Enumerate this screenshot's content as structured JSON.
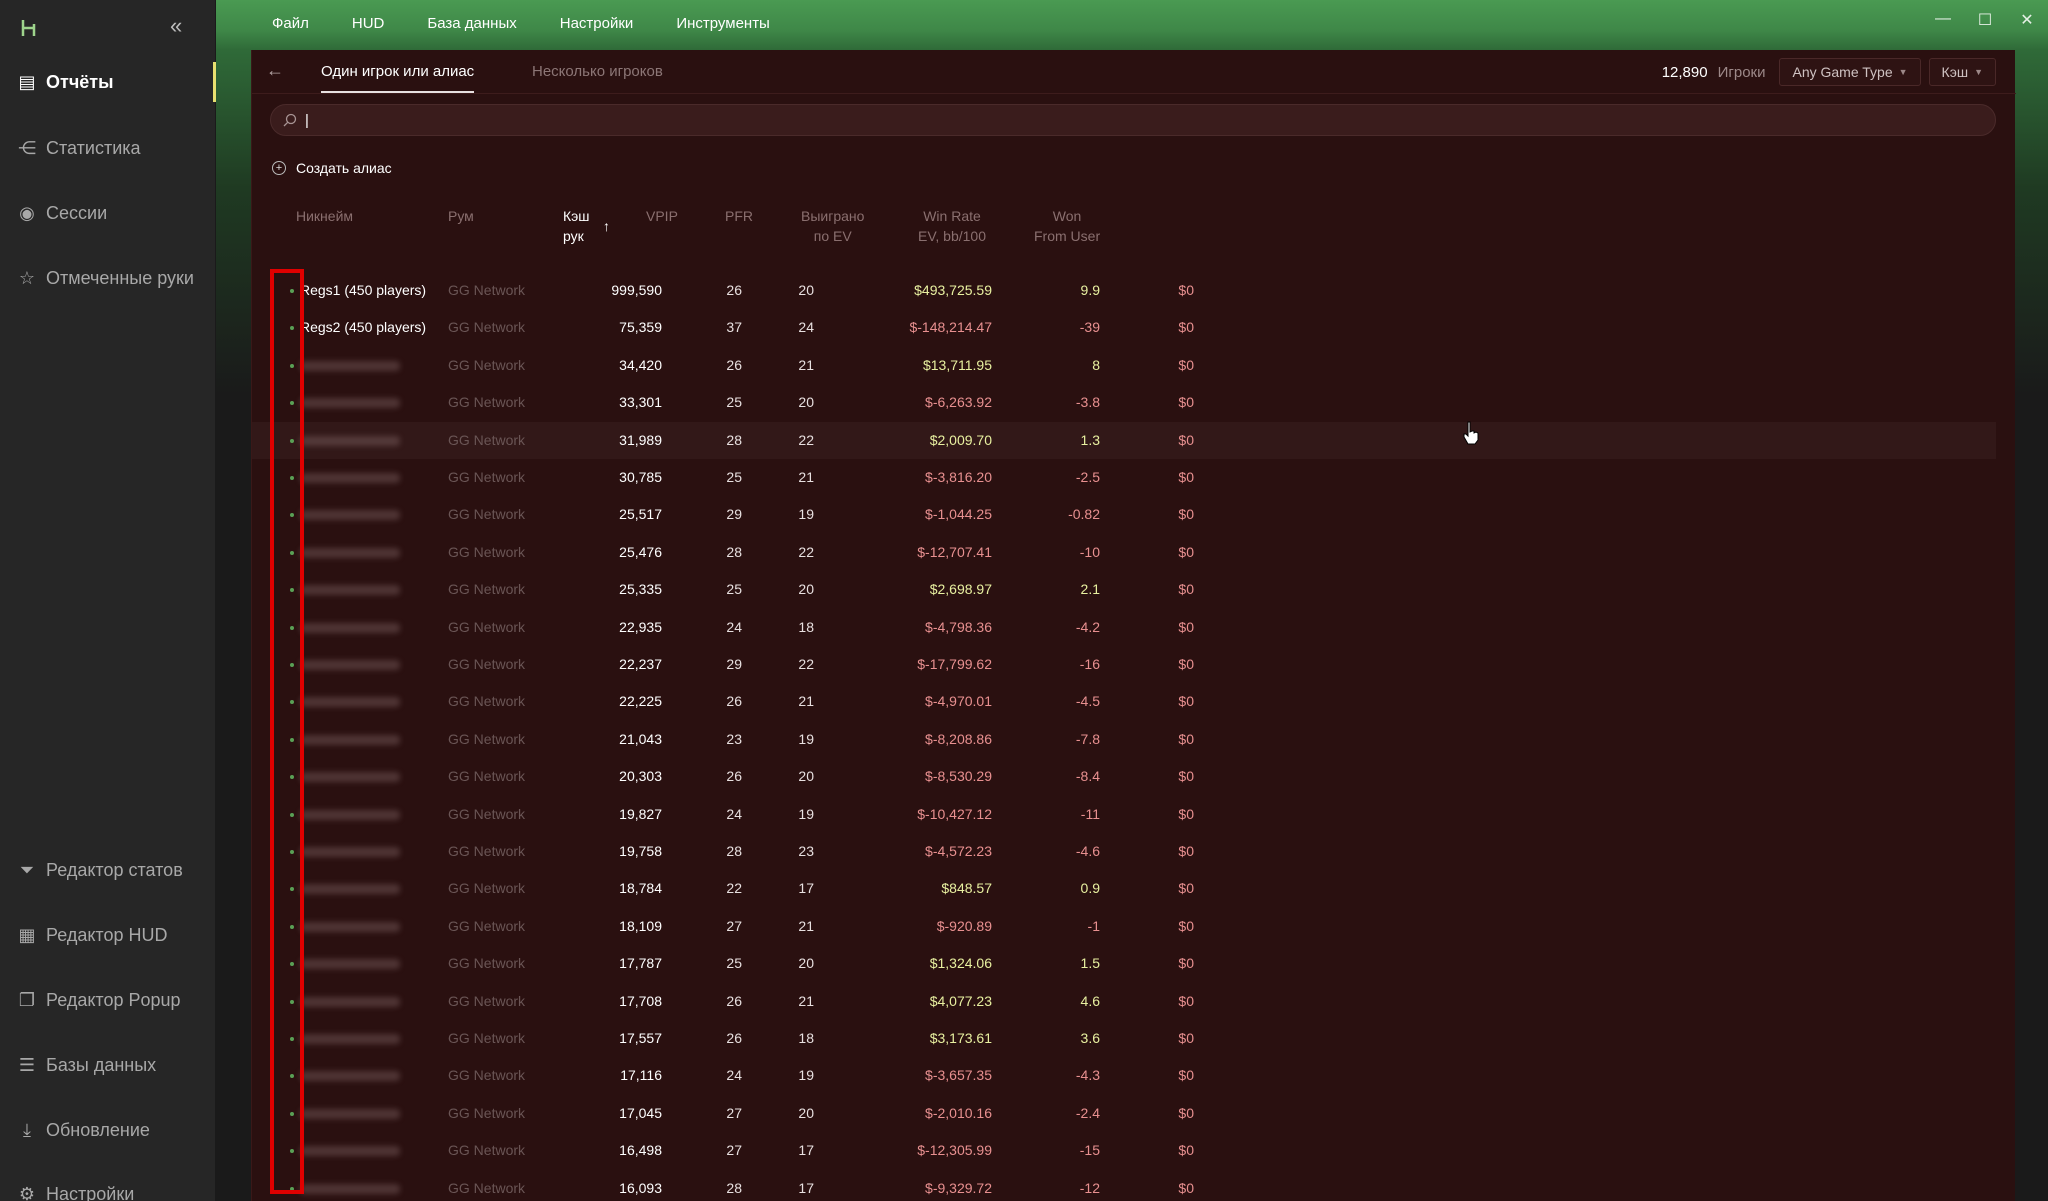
{
  "sidebar": {
    "items": [
      {
        "label": "Отчёты",
        "icon": "report-icon",
        "active": true
      },
      {
        "label": "Статистика",
        "icon": "share-icon"
      },
      {
        "label": "Сессии",
        "icon": "broadcast-icon"
      },
      {
        "label": "Отмеченные руки",
        "icon": "starred-list-icon"
      }
    ],
    "bottom_items": [
      {
        "label": "Редактор статов",
        "icon": "filter-icon"
      },
      {
        "label": "Редактор HUD",
        "icon": "layout-icon"
      },
      {
        "label": "Редактор Popup",
        "icon": "copy-icon"
      },
      {
        "label": "Базы данных",
        "icon": "database-icon"
      },
      {
        "label": "Обновление",
        "icon": "download-icon"
      },
      {
        "label": "Настройки",
        "icon": "gear-icon"
      }
    ]
  },
  "menu": [
    "Файл",
    "HUD",
    "База данных",
    "Настройки",
    "Инструменты"
  ],
  "tabs": {
    "single": "Один игрок или алиас",
    "multi": "Несколько игроков"
  },
  "header": {
    "player_count": "12,890",
    "player_count_label": "Игроки",
    "game_type": "Any Game Type",
    "mode": "Кэш"
  },
  "search": {
    "value": "|"
  },
  "create_alias": "Создать алиас",
  "columns": {
    "nick": "Никнейм",
    "room": "Рум",
    "hands_1": "Кэш",
    "hands_2": "рук",
    "sort_arrow": "↑",
    "vpip": "VPIP",
    "pfr": "PFR",
    "won_1": "Выиграно",
    "won_2": "по EV",
    "wr_1": "Win Rate",
    "wr_2": "EV, bb/100",
    "wfu_1": "Won",
    "wfu_2": "From User"
  },
  "rows": [
    {
      "nick": "Regs1 (450 players)",
      "room": "GG Network",
      "hands": "999,590",
      "vpip": "26",
      "pfr": "20",
      "won": "$493,725.59",
      "wr": "9.9",
      "wfu": "$0"
    },
    {
      "nick": "Regs2 (450 players)",
      "room": "GG Network",
      "hands": "75,359",
      "vpip": "37",
      "pfr": "24",
      "won": "$-148,214.47",
      "wr": "-39",
      "wfu": "$0"
    },
    {
      "nick": "",
      "room": "GG Network",
      "hands": "34,420",
      "vpip": "26",
      "pfr": "21",
      "won": "$13,711.95",
      "wr": "8",
      "wfu": "$0"
    },
    {
      "nick": "",
      "room": "GG Network",
      "hands": "33,301",
      "vpip": "25",
      "pfr": "20",
      "won": "$-6,263.92",
      "wr": "-3.8",
      "wfu": "$0"
    },
    {
      "nick": "",
      "room": "GG Network",
      "hands": "31,989",
      "vpip": "28",
      "pfr": "22",
      "won": "$2,009.70",
      "wr": "1.3",
      "wfu": "$0"
    },
    {
      "nick": "",
      "room": "GG Network",
      "hands": "30,785",
      "vpip": "25",
      "pfr": "21",
      "won": "$-3,816.20",
      "wr": "-2.5",
      "wfu": "$0"
    },
    {
      "nick": "",
      "room": "GG Network",
      "hands": "25,517",
      "vpip": "29",
      "pfr": "19",
      "won": "$-1,044.25",
      "wr": "-0.82",
      "wfu": "$0"
    },
    {
      "nick": "",
      "room": "GG Network",
      "hands": "25,476",
      "vpip": "28",
      "pfr": "22",
      "won": "$-12,707.41",
      "wr": "-10",
      "wfu": "$0"
    },
    {
      "nick": "",
      "room": "GG Network",
      "hands": "25,335",
      "vpip": "25",
      "pfr": "20",
      "won": "$2,698.97",
      "wr": "2.1",
      "wfu": "$0"
    },
    {
      "nick": "",
      "room": "GG Network",
      "hands": "22,935",
      "vpip": "24",
      "pfr": "18",
      "won": "$-4,798.36",
      "wr": "-4.2",
      "wfu": "$0"
    },
    {
      "nick": "",
      "room": "GG Network",
      "hands": "22,237",
      "vpip": "29",
      "pfr": "22",
      "won": "$-17,799.62",
      "wr": "-16",
      "wfu": "$0"
    },
    {
      "nick": "",
      "room": "GG Network",
      "hands": "22,225",
      "vpip": "26",
      "pfr": "21",
      "won": "$-4,970.01",
      "wr": "-4.5",
      "wfu": "$0"
    },
    {
      "nick": "",
      "room": "GG Network",
      "hands": "21,043",
      "vpip": "23",
      "pfr": "19",
      "won": "$-8,208.86",
      "wr": "-7.8",
      "wfu": "$0"
    },
    {
      "nick": "",
      "room": "GG Network",
      "hands": "20,303",
      "vpip": "26",
      "pfr": "20",
      "won": "$-8,530.29",
      "wr": "-8.4",
      "wfu": "$0"
    },
    {
      "nick": "",
      "room": "GG Network",
      "hands": "19,827",
      "vpip": "24",
      "pfr": "19",
      "won": "$-10,427.12",
      "wr": "-11",
      "wfu": "$0"
    },
    {
      "nick": "",
      "room": "GG Network",
      "hands": "19,758",
      "vpip": "28",
      "pfr": "23",
      "won": "$-4,572.23",
      "wr": "-4.6",
      "wfu": "$0"
    },
    {
      "nick": "",
      "room": "GG Network",
      "hands": "18,784",
      "vpip": "22",
      "pfr": "17",
      "won": "$848.57",
      "wr": "0.9",
      "wfu": "$0"
    },
    {
      "nick": "",
      "room": "GG Network",
      "hands": "18,109",
      "vpip": "27",
      "pfr": "21",
      "won": "$-920.89",
      "wr": "-1",
      "wfu": "$0"
    },
    {
      "nick": "",
      "room": "GG Network",
      "hands": "17,787",
      "vpip": "25",
      "pfr": "20",
      "won": "$1,324.06",
      "wr": "1.5",
      "wfu": "$0"
    },
    {
      "nick": "",
      "room": "GG Network",
      "hands": "17,708",
      "vpip": "26",
      "pfr": "21",
      "won": "$4,077.23",
      "wr": "4.6",
      "wfu": "$0"
    },
    {
      "nick": "",
      "room": "GG Network",
      "hands": "17,557",
      "vpip": "26",
      "pfr": "18",
      "won": "$3,173.61",
      "wr": "3.6",
      "wfu": "$0"
    },
    {
      "nick": "",
      "room": "GG Network",
      "hands": "17,116",
      "vpip": "24",
      "pfr": "19",
      "won": "$-3,657.35",
      "wr": "-4.3",
      "wfu": "$0"
    },
    {
      "nick": "",
      "room": "GG Network",
      "hands": "17,045",
      "vpip": "27",
      "pfr": "20",
      "won": "$-2,010.16",
      "wr": "-2.4",
      "wfu": "$0"
    },
    {
      "nick": "",
      "room": "GG Network",
      "hands": "16,498",
      "vpip": "27",
      "pfr": "17",
      "won": "$-12,305.99",
      "wr": "-15",
      "wfu": "$0"
    },
    {
      "nick": "",
      "room": "GG Network",
      "hands": "16,093",
      "vpip": "28",
      "pfr": "17",
      "won": "$-9,329.72",
      "wr": "-12",
      "wfu": "$0"
    }
  ],
  "colors": {
    "positive": "#e8f0a0",
    "negative": "#e89090",
    "accent": "#e8e070",
    "highlight_box": "#e00000"
  }
}
